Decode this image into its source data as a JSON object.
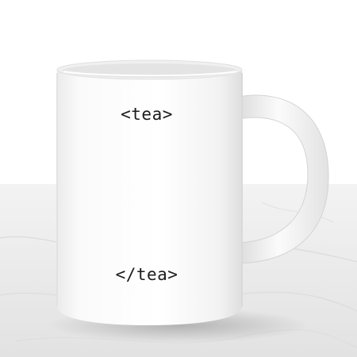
{
  "mug": {
    "open_tag": "<tea>",
    "close_tag": "</tea>"
  },
  "colors": {
    "background_wall": "#ffffff",
    "tabletop": "#e9e9e9",
    "mug_body": "#f8f8f8",
    "text": "#1c1c1c"
  }
}
